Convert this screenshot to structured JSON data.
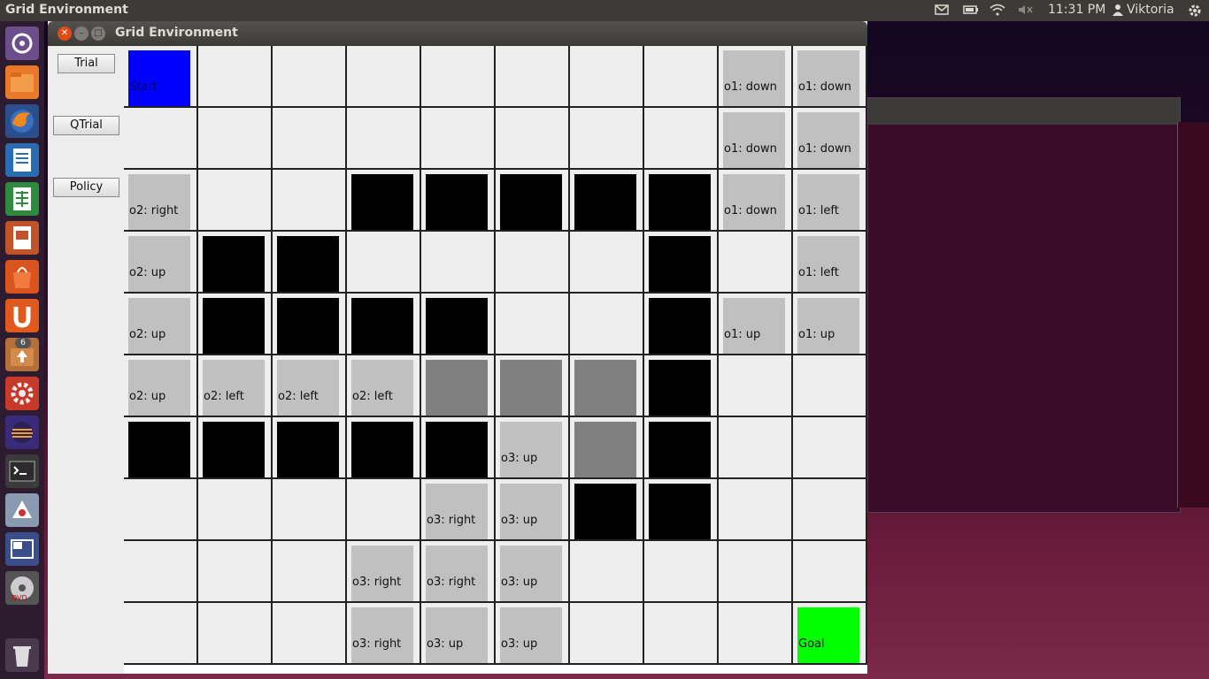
{
  "top_panel": {
    "app_name": "Grid Environment",
    "time": "11:31 PM",
    "user": "Viktoria"
  },
  "launcher": {
    "items": [
      "dash-icon",
      "files-icon",
      "firefox-icon",
      "writer-icon",
      "calc-icon",
      "impress-icon",
      "software-center-icon",
      "ubuntu-one-icon",
      "update-icon",
      "settings-icon",
      "eclipse-icon",
      "terminal-icon",
      "java-icon",
      "workspace-icon",
      "dvd-icon",
      "trash-icon"
    ],
    "update_badge": "6"
  },
  "window": {
    "title": "Grid Environment"
  },
  "buttons": {
    "trial": "Trial",
    "qtrial": "QTrial",
    "policy": "Policy"
  },
  "grid": {
    "rows": [
      [
        {
          "k": "start",
          "t": "Start"
        },
        {
          "k": "empty",
          "t": ""
        },
        {
          "k": "empty",
          "t": ""
        },
        {
          "k": "empty",
          "t": ""
        },
        {
          "k": "empty",
          "t": ""
        },
        {
          "k": "empty",
          "t": ""
        },
        {
          "k": "empty",
          "t": ""
        },
        {
          "k": "empty",
          "t": ""
        },
        {
          "k": "sub",
          "t": "o1: down"
        },
        {
          "k": "sub",
          "t": "o1: down"
        }
      ],
      [
        {
          "k": "empty",
          "t": ""
        },
        {
          "k": "empty",
          "t": ""
        },
        {
          "k": "empty",
          "t": ""
        },
        {
          "k": "empty",
          "t": ""
        },
        {
          "k": "empty",
          "t": ""
        },
        {
          "k": "empty",
          "t": ""
        },
        {
          "k": "empty",
          "t": ""
        },
        {
          "k": "empty",
          "t": ""
        },
        {
          "k": "sub",
          "t": "o1: down"
        },
        {
          "k": "sub",
          "t": "o1: down"
        }
      ],
      [
        {
          "k": "sub",
          "t": "o2: right"
        },
        {
          "k": "empty",
          "t": ""
        },
        {
          "k": "empty",
          "t": ""
        },
        {
          "k": "wall",
          "t": ""
        },
        {
          "k": "wall",
          "t": ""
        },
        {
          "k": "wall",
          "t": ""
        },
        {
          "k": "wall",
          "t": ""
        },
        {
          "k": "wall",
          "t": ""
        },
        {
          "k": "sub",
          "t": "o1: down"
        },
        {
          "k": "sub",
          "t": "o1: left"
        }
      ],
      [
        {
          "k": "sub",
          "t": "o2: up"
        },
        {
          "k": "wall",
          "t": ""
        },
        {
          "k": "wall",
          "t": ""
        },
        {
          "k": "empty",
          "t": ""
        },
        {
          "k": "empty",
          "t": ""
        },
        {
          "k": "empty",
          "t": ""
        },
        {
          "k": "empty",
          "t": ""
        },
        {
          "k": "wall",
          "t": ""
        },
        {
          "k": "empty",
          "t": ""
        },
        {
          "k": "sub",
          "t": "o1: left"
        }
      ],
      [
        {
          "k": "sub",
          "t": "o2: up"
        },
        {
          "k": "wall",
          "t": ""
        },
        {
          "k": "wall",
          "t": ""
        },
        {
          "k": "wall",
          "t": ""
        },
        {
          "k": "wall",
          "t": ""
        },
        {
          "k": "empty",
          "t": ""
        },
        {
          "k": "empty",
          "t": ""
        },
        {
          "k": "wall",
          "t": ""
        },
        {
          "k": "sub",
          "t": "o1: up"
        },
        {
          "k": "sub",
          "t": "o1: up"
        }
      ],
      [
        {
          "k": "sub",
          "t": "o2: up"
        },
        {
          "k": "sub",
          "t": "o2: left"
        },
        {
          "k": "sub",
          "t": "o2: left"
        },
        {
          "k": "sub",
          "t": "o2: left"
        },
        {
          "k": "dark",
          "t": ""
        },
        {
          "k": "dark",
          "t": ""
        },
        {
          "k": "dark",
          "t": ""
        },
        {
          "k": "wall",
          "t": ""
        },
        {
          "k": "empty",
          "t": ""
        },
        {
          "k": "empty",
          "t": ""
        }
      ],
      [
        {
          "k": "wall",
          "t": ""
        },
        {
          "k": "wall",
          "t": ""
        },
        {
          "k": "wall",
          "t": ""
        },
        {
          "k": "wall",
          "t": ""
        },
        {
          "k": "wall",
          "t": ""
        },
        {
          "k": "sub",
          "t": "o3: up"
        },
        {
          "k": "dark",
          "t": ""
        },
        {
          "k": "wall",
          "t": ""
        },
        {
          "k": "empty",
          "t": ""
        },
        {
          "k": "empty",
          "t": ""
        }
      ],
      [
        {
          "k": "empty",
          "t": ""
        },
        {
          "k": "empty",
          "t": ""
        },
        {
          "k": "empty",
          "t": ""
        },
        {
          "k": "empty",
          "t": ""
        },
        {
          "k": "sub",
          "t": "o3: right"
        },
        {
          "k": "sub",
          "t": "o3: up"
        },
        {
          "k": "wall",
          "t": ""
        },
        {
          "k": "wall",
          "t": ""
        },
        {
          "k": "empty",
          "t": ""
        },
        {
          "k": "empty",
          "t": ""
        }
      ],
      [
        {
          "k": "empty",
          "t": ""
        },
        {
          "k": "empty",
          "t": ""
        },
        {
          "k": "empty",
          "t": ""
        },
        {
          "k": "sub",
          "t": "o3: right"
        },
        {
          "k": "sub",
          "t": "o3: right"
        },
        {
          "k": "sub",
          "t": "o3: up"
        },
        {
          "k": "empty",
          "t": ""
        },
        {
          "k": "empty",
          "t": ""
        },
        {
          "k": "empty",
          "t": ""
        },
        {
          "k": "empty",
          "t": ""
        }
      ],
      [
        {
          "k": "empty",
          "t": ""
        },
        {
          "k": "empty",
          "t": ""
        },
        {
          "k": "empty",
          "t": ""
        },
        {
          "k": "sub",
          "t": "o3: right"
        },
        {
          "k": "sub",
          "t": "o3: up"
        },
        {
          "k": "sub",
          "t": "o3: up"
        },
        {
          "k": "empty",
          "t": ""
        },
        {
          "k": "empty",
          "t": ""
        },
        {
          "k": "empty",
          "t": ""
        },
        {
          "k": "goal",
          "t": "Goal"
        }
      ]
    ]
  }
}
